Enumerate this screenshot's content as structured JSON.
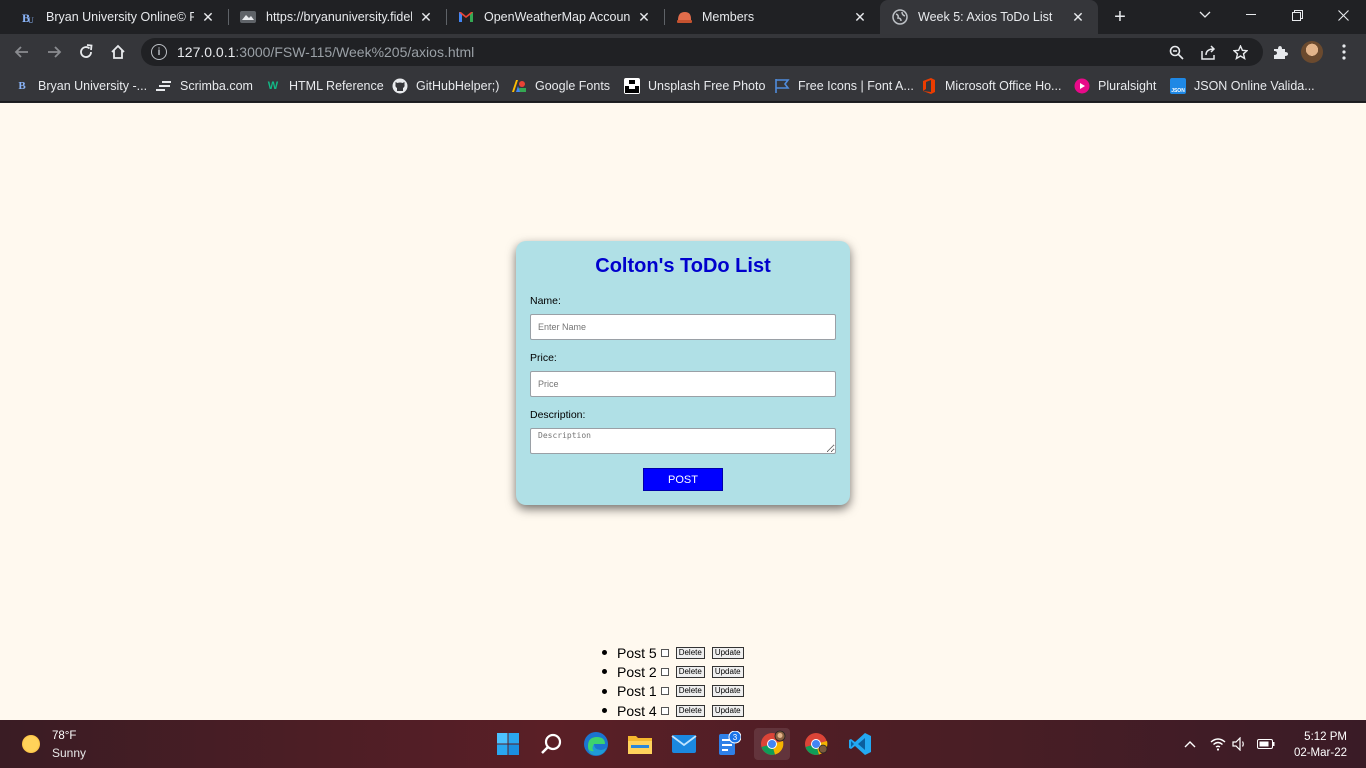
{
  "browser": {
    "tabs": [
      {
        "title": "Bryan University Online© Fo",
        "icon": "bryan-university-icon",
        "active": false
      },
      {
        "title": "https://bryanuniversity.fidelis",
        "icon": "fidelis-icon",
        "active": false
      },
      {
        "title": "OpenWeatherMap Account c",
        "icon": "gmail-icon",
        "active": false
      },
      {
        "title": "Members",
        "icon": "members-icon",
        "active": false
      },
      {
        "title": "Week 5: Axios ToDo List",
        "icon": "globe-icon",
        "active": true
      }
    ],
    "address": {
      "host": "127.0.0.1",
      "path": ":3000/FSW-115/Week%205/axios.html"
    },
    "bookmarks": [
      {
        "label": "Bryan University -...",
        "icon": "bryan-university-icon"
      },
      {
        "label": "Scrimba.com",
        "icon": "scrimba-icon"
      },
      {
        "label": "HTML Reference",
        "icon": "html-reference-icon"
      },
      {
        "label": "GitHubHelper;)",
        "icon": "github-icon"
      },
      {
        "label": "Google Fonts",
        "icon": "google-fonts-icon"
      },
      {
        "label": "Unsplash Free Photo",
        "icon": "unsplash-icon"
      },
      {
        "label": "Free Icons | Font A...",
        "icon": "font-awesome-icon"
      },
      {
        "label": "Microsoft Office Ho...",
        "icon": "office-icon"
      },
      {
        "label": "Pluralsight",
        "icon": "pluralsight-icon"
      },
      {
        "label": "JSON Online Valida...",
        "icon": "json-icon"
      }
    ]
  },
  "todo": {
    "title": "Colton's ToDo List",
    "name_label": "Name:",
    "name_placeholder": "Enter Name",
    "price_label": "Price:",
    "price_placeholder": "Price",
    "description_label": "Description:",
    "description_placeholder": "Description",
    "post_button": "POST",
    "items": [
      {
        "title": "Post 5",
        "delete": "Delete",
        "update": "Update",
        "completed": false
      },
      {
        "title": "Post 2",
        "delete": "Delete",
        "update": "Update",
        "completed": false
      },
      {
        "title": "Post 1",
        "delete": "Delete",
        "update": "Update",
        "completed": false
      },
      {
        "title": "Post 4",
        "delete": "Delete",
        "update": "Update",
        "completed": false
      }
    ]
  },
  "taskbar": {
    "weather_temp": "78°F",
    "weather_desc": "Sunny",
    "time": "5:12 PM",
    "date": "02-Mar-22",
    "mail_badge": "3"
  },
  "colors": {
    "page_bg": "#fff9ef",
    "card_bg": "#b0e0e6",
    "title_color": "#0000cd",
    "post_button_bg": "#0000ff"
  }
}
